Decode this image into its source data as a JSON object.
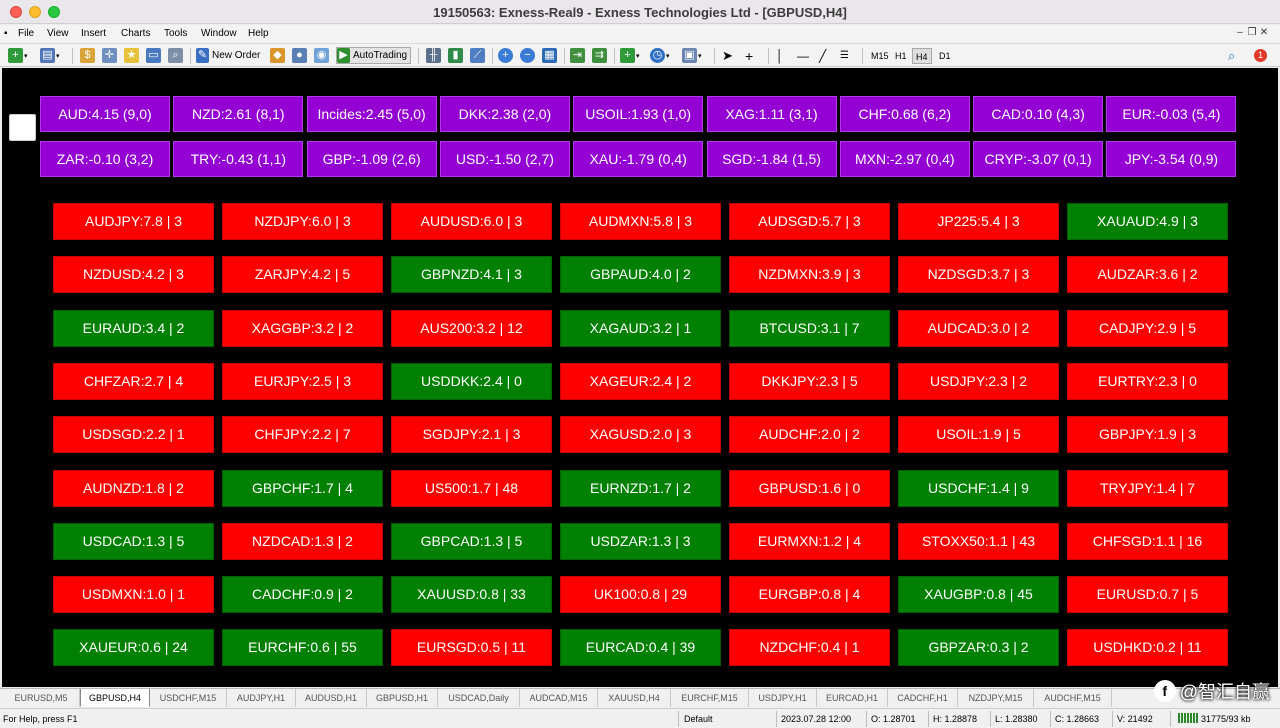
{
  "window": {
    "title": "19150563: Exness-Real9 - Exness Technologies Ltd - [GBPUSD,H4]"
  },
  "menu": {
    "items": [
      {
        "label": "File"
      },
      {
        "label": "View"
      },
      {
        "label": "Insert"
      },
      {
        "label": "Charts"
      },
      {
        "label": "Tools"
      },
      {
        "label": "Window"
      },
      {
        "label": "Help"
      }
    ],
    "mdi_controls": [
      "–",
      "❐",
      "✕"
    ]
  },
  "toolbar": {
    "new_order_label": "New Order",
    "autotrading_label": "AutoTrading",
    "timeframes": [
      "M15",
      "H1",
      "H4",
      "D1"
    ],
    "active_timeframe": "H4",
    "alert_count": "1"
  },
  "currency_strength": [
    "AUD:4.15 (9,0)",
    "NZD:2.61 (8,1)",
    "Incides:2.45 (5,0)",
    "DKK:2.38 (2,0)",
    "USOIL:1.93 (1,0)",
    "XAG:1.11 (3,1)",
    "CHF:0.68 (6,2)",
    "CAD:0.10 (4,3)",
    "EUR:-0.03 (5,4)",
    "ZAR:-0.10 (3,2)",
    "TRY:-0.43 (1,1)",
    "GBP:-1.09 (2,6)",
    "USD:-1.50 (2,7)",
    "XAU:-1.79 (0,4)",
    "SGD:-1.84 (1,5)",
    "MXN:-2.97 (0,4)",
    "CRYP:-3.07 (0,1)",
    "JPY:-3.54 (0,9)"
  ],
  "pairs": [
    {
      "label": "AUDJPY:7.8 | 3",
      "color": "red"
    },
    {
      "label": "NZDJPY:6.0 | 3",
      "color": "red"
    },
    {
      "label": "AUDUSD:6.0 | 3",
      "color": "red"
    },
    {
      "label": "AUDMXN:5.8 | 3",
      "color": "red"
    },
    {
      "label": "AUDSGD:5.7 | 3",
      "color": "red"
    },
    {
      "label": "JP225:5.4 | 3",
      "color": "red"
    },
    {
      "label": "XAUAUD:4.9 | 3",
      "color": "green"
    },
    {
      "label": "NZDUSD:4.2 | 3",
      "color": "red"
    },
    {
      "label": "ZARJPY:4.2 | 5",
      "color": "red"
    },
    {
      "label": "GBPNZD:4.1 | 3",
      "color": "green"
    },
    {
      "label": "GBPAUD:4.0 | 2",
      "color": "green"
    },
    {
      "label": "NZDMXN:3.9 | 3",
      "color": "red"
    },
    {
      "label": "NZDSGD:3.7 | 3",
      "color": "red"
    },
    {
      "label": "AUDZAR:3.6 | 2",
      "color": "red"
    },
    {
      "label": "EURAUD:3.4 | 2",
      "color": "green"
    },
    {
      "label": "XAGGBP:3.2 | 2",
      "color": "red"
    },
    {
      "label": "AUS200:3.2 | 12",
      "color": "red"
    },
    {
      "label": "XAGAUD:3.2 | 1",
      "color": "green"
    },
    {
      "label": "BTCUSD:3.1 | 7",
      "color": "green"
    },
    {
      "label": "AUDCAD:3.0 | 2",
      "color": "red"
    },
    {
      "label": "CADJPY:2.9 | 5",
      "color": "red"
    },
    {
      "label": "CHFZAR:2.7 | 4",
      "color": "red"
    },
    {
      "label": "EURJPY:2.5 | 3",
      "color": "red"
    },
    {
      "label": "USDDKK:2.4 | 0",
      "color": "green"
    },
    {
      "label": "XAGEUR:2.4 | 2",
      "color": "red"
    },
    {
      "label": "DKKJPY:2.3 | 5",
      "color": "red"
    },
    {
      "label": "USDJPY:2.3 | 2",
      "color": "red"
    },
    {
      "label": "EURTRY:2.3 | 0",
      "color": "red"
    },
    {
      "label": "USDSGD:2.2 | 1",
      "color": "red"
    },
    {
      "label": "CHFJPY:2.2 | 7",
      "color": "red"
    },
    {
      "label": "SGDJPY:2.1 | 3",
      "color": "red"
    },
    {
      "label": "XAGUSD:2.0 | 3",
      "color": "red"
    },
    {
      "label": "AUDCHF:2.0 | 2",
      "color": "red"
    },
    {
      "label": "USOIL:1.9 | 5",
      "color": "red"
    },
    {
      "label": "GBPJPY:1.9 | 3",
      "color": "red"
    },
    {
      "label": "AUDNZD:1.8 | 2",
      "color": "red"
    },
    {
      "label": "GBPCHF:1.7 | 4",
      "color": "green"
    },
    {
      "label": "US500:1.7 | 48",
      "color": "red"
    },
    {
      "label": "EURNZD:1.7 | 2",
      "color": "green"
    },
    {
      "label": "GBPUSD:1.6 | 0",
      "color": "red"
    },
    {
      "label": "USDCHF:1.4 | 9",
      "color": "green"
    },
    {
      "label": "TRYJPY:1.4 | 7",
      "color": "red"
    },
    {
      "label": "USDCAD:1.3 | 5",
      "color": "green"
    },
    {
      "label": "NZDCAD:1.3 | 2",
      "color": "red"
    },
    {
      "label": "GBPCAD:1.3 | 5",
      "color": "green"
    },
    {
      "label": "USDZAR:1.3 | 3",
      "color": "green"
    },
    {
      "label": "EURMXN:1.2 | 4",
      "color": "red"
    },
    {
      "label": "STOXX50:1.1 | 43",
      "color": "red"
    },
    {
      "label": "CHFSGD:1.1 | 16",
      "color": "red"
    },
    {
      "label": "USDMXN:1.0 | 1",
      "color": "red"
    },
    {
      "label": "CADCHF:0.9 | 2",
      "color": "green"
    },
    {
      "label": "XAUUSD:0.8 | 33",
      "color": "green"
    },
    {
      "label": "UK100:0.8 | 29",
      "color": "red"
    },
    {
      "label": "EURGBP:0.8 | 4",
      "color": "red"
    },
    {
      "label": "XAUGBP:0.8 | 45",
      "color": "green"
    },
    {
      "label": "EURUSD:0.7 | 5",
      "color": "red"
    },
    {
      "label": "XAUEUR:0.6 | 24",
      "color": "green"
    },
    {
      "label": "EURCHF:0.6 | 55",
      "color": "green"
    },
    {
      "label": "EURSGD:0.5 | 11",
      "color": "red"
    },
    {
      "label": "EURCAD:0.4 | 39",
      "color": "green"
    },
    {
      "label": "NZDCHF:0.4 | 1",
      "color": "red"
    },
    {
      "label": "GBPZAR:0.3 | 2",
      "color": "green"
    },
    {
      "label": "USDHKD:0.2 | 11",
      "color": "red"
    }
  ],
  "tabs": [
    {
      "label": "EURUSD,M5"
    },
    {
      "label": "GBPUSD,H4",
      "active": true
    },
    {
      "label": "USDCHF,M15"
    },
    {
      "label": "AUDJPY,H1"
    },
    {
      "label": "AUDUSD,H1"
    },
    {
      "label": "GBPUSD,H1"
    },
    {
      "label": "USDCAD,Daily"
    },
    {
      "label": "AUDCAD,M15"
    },
    {
      "label": "XAUUSD,H4"
    },
    {
      "label": "EURCHF,M15"
    },
    {
      "label": "USDJPY,H1"
    },
    {
      "label": "EURCAD,H1"
    },
    {
      "label": "CADCHF,H1"
    },
    {
      "label": "NZDJPY,M15"
    },
    {
      "label": "AUDCHF,M15"
    }
  ],
  "watermark": {
    "logo": "f",
    "text": "@智汇自赢"
  },
  "status": {
    "help": "For Help, press F1",
    "profile": "Default",
    "datetime": "2023.07.28 12:00",
    "open": "O: 1.28701",
    "high": "H: 1.28878",
    "low": "L: 1.28380",
    "close": "C: 1.28663",
    "volume": "V: 21492",
    "traffic": "31775/93 kb"
  },
  "colors": {
    "red": "#ff0000",
    "green": "#008000",
    "currency": "#9400d3"
  }
}
